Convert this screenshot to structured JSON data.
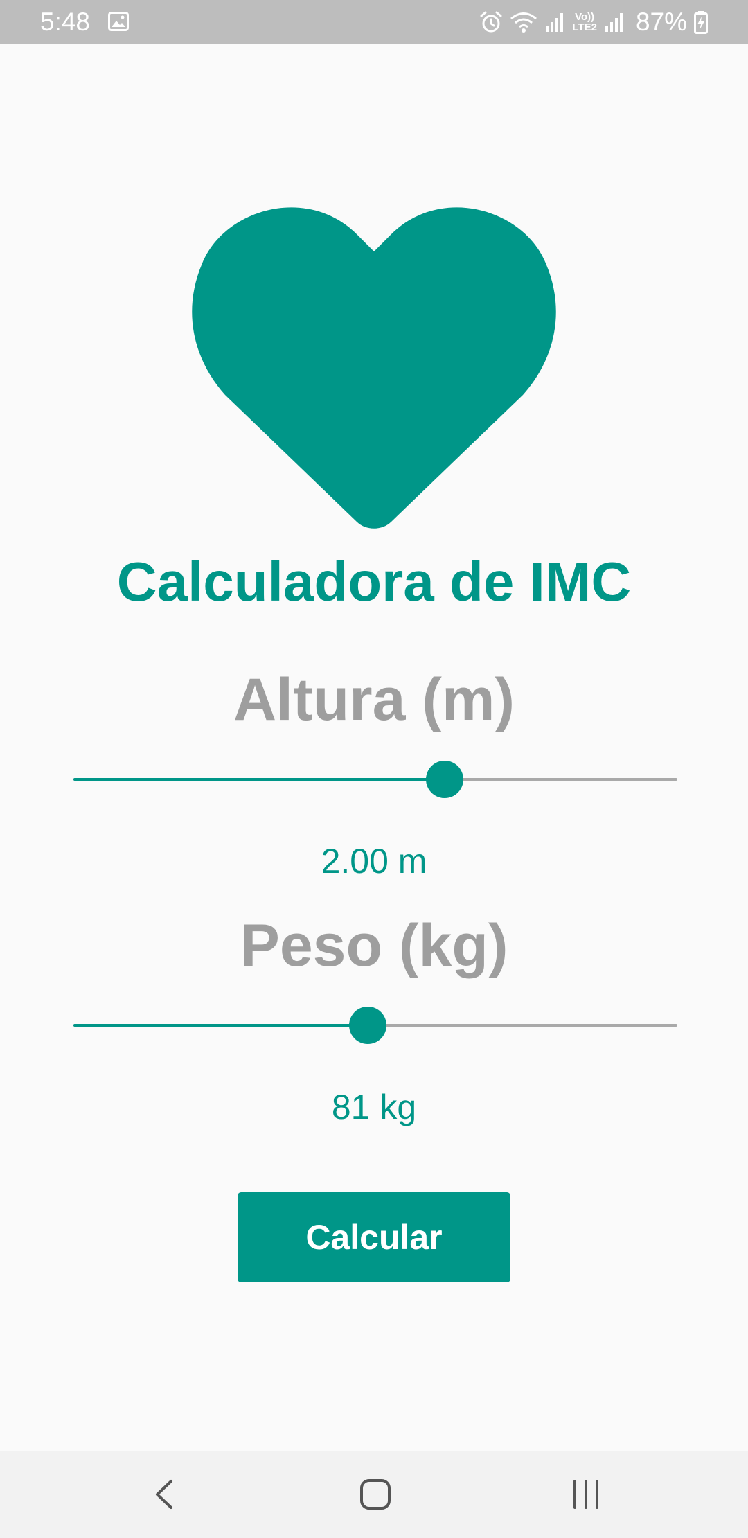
{
  "status_bar": {
    "time": "5:48",
    "battery": "87%",
    "volte_label": "Vo))",
    "lte_label": "LTE2",
    "icons": [
      "gallery-icon",
      "alarm-icon",
      "wifi-icon",
      "signal-icon",
      "battery-charging-icon"
    ]
  },
  "app": {
    "title": "Calculadora de IMC",
    "logo_icon": "heart-icon",
    "accent_color": "#009688",
    "label_color": "#9E9E9E"
  },
  "height_section": {
    "label": "Altura (m)",
    "value_text": "2.00 m",
    "slider_fraction": 0.615
  },
  "weight_section": {
    "label": "Peso (kg)",
    "value_text": "81 kg",
    "slider_fraction": 0.487
  },
  "calculate_button": {
    "label": "Calcular"
  },
  "nav_bar": {
    "icons": [
      "back-icon",
      "home-icon",
      "recents-icon"
    ]
  }
}
